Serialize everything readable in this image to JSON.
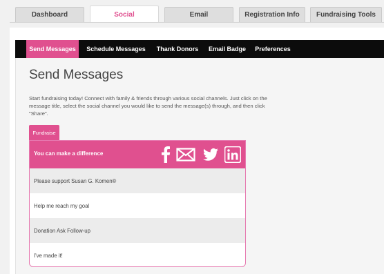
{
  "top_tabs": [
    {
      "label": "Dashboard"
    },
    {
      "label": "Social"
    },
    {
      "label": "Email"
    },
    {
      "label": "Registration Info"
    },
    {
      "label": "Fundraising Tools"
    }
  ],
  "active_top_tab": "Social",
  "subnav": [
    {
      "label": "Send Messages"
    },
    {
      "label": "Schedule Messages"
    },
    {
      "label": "Thank Donors"
    },
    {
      "label": "Email Badge"
    },
    {
      "label": "Preferences"
    }
  ],
  "active_subnav": "Send Messages",
  "page": {
    "title": "Send Messages",
    "intro": "Start fundraising today! Connect with family & friends through various social channels. Just click on the message title, select the social channel you would like to send the message(s) through, and then click \"Share\"."
  },
  "fundraise": {
    "tab_label": "Fundraise",
    "header": "You can make a difference",
    "social_icons": [
      "facebook-icon",
      "email-icon",
      "twitter-icon",
      "linkedin-icon"
    ],
    "messages": [
      {
        "title": "Please support Susan G. Komen®"
      },
      {
        "title": "Help me reach my goal"
      },
      {
        "title": "Donation Ask Follow-up"
      },
      {
        "title": "I've made it!"
      }
    ]
  },
  "colors": {
    "accent": "#e0508f",
    "nav_bg": "#0c0c0c",
    "page_bg": "#f1f1f1"
  }
}
